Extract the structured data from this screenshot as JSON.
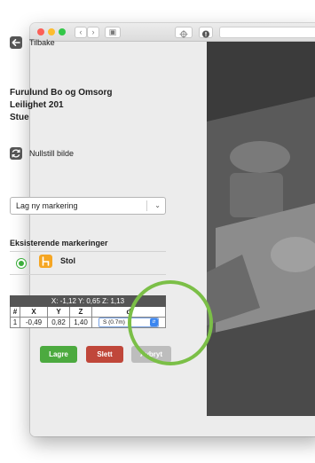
{
  "colors": {
    "save": "#4caa3f",
    "delete": "#c0473a",
    "cancel": "#bdbdbd",
    "accent": "#3dae3d",
    "marker": "#f5a623"
  },
  "icons": {
    "back": "arrow-left-icon",
    "reset": "refresh-icon",
    "marker": "chair-icon",
    "dropdown": "chevron-down-icon"
  },
  "nav": {
    "back_label": "Tilbake"
  },
  "location": {
    "line1": "Furulund Bo og Omsorg",
    "line2": "Leilighet 201",
    "line3": "Stue"
  },
  "reset_label": "Nullstill bilde",
  "marking_select": {
    "selected": "Lag ny markering"
  },
  "existing": {
    "title": "Eksisterende markeringer",
    "items": [
      {
        "label": "Stol",
        "selected": true
      }
    ]
  },
  "coords": {
    "caption": "X: -1,12  Y: 0,65  Z: 1,13",
    "headers": [
      "#",
      "X",
      "Y",
      "Z",
      "d"
    ],
    "row": {
      "index": "1",
      "x": "-0,49",
      "y": "0,82",
      "z": "1,40",
      "d": "S (0.7m)"
    }
  },
  "actions": {
    "save": "Lagre",
    "delete": "Slett",
    "cancel": "Avbryt"
  }
}
